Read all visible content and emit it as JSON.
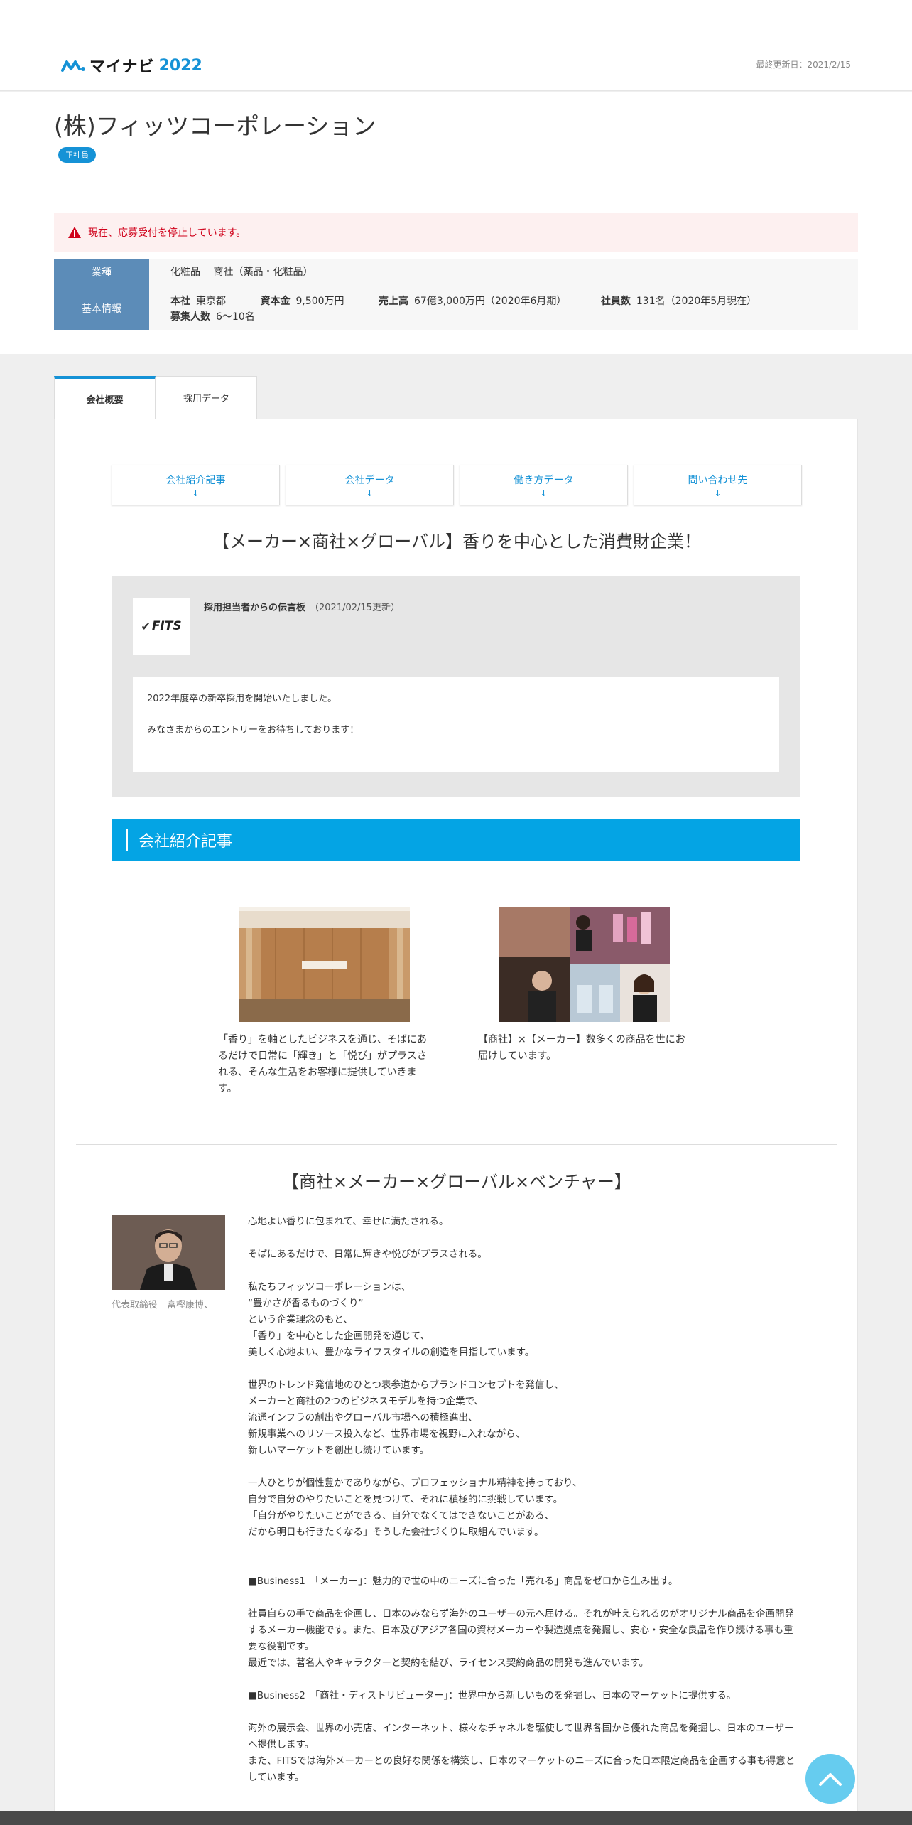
{
  "header": {
    "logo_text": "マイナビ",
    "logo_year": "2022",
    "updated": "最終更新日：2021/2/15"
  },
  "company": {
    "name": "(株)フィッツコーポレーション",
    "badge": "正社員",
    "alert": "現在、応募受付を停止しています。",
    "info": {
      "industry_label": "業種",
      "industry_value": "化粧品　 商社（薬品・化粧品）",
      "basic_label": "基本情報",
      "hq_key": "本社",
      "hq_val": "東京都",
      "capital_key": "資本金",
      "capital_val": "9,500万円",
      "sales_key": "売上高",
      "sales_val": "67億3,000万円（2020年6月期）",
      "employees_key": "社員数",
      "employees_val": "131名（2020年5月現在）",
      "recruit_key": "募集人数",
      "recruit_val": "6～10名"
    }
  },
  "tabs": [
    {
      "label": "会社概要"
    },
    {
      "label": "採用データ"
    }
  ],
  "subnav": [
    {
      "label": "会社紹介記事",
      "arrow": "↓"
    },
    {
      "label": "会社データ",
      "arrow": "↓"
    },
    {
      "label": "働き方データ",
      "arrow": "↓"
    },
    {
      "label": "問い合わせ先",
      "arrow": "↓"
    }
  ],
  "catchphrase": "【メーカー×商社×グローバル】香りを中心とした消費財企業！",
  "message": {
    "logo_text": "FITS",
    "title": "採用担当者からの伝言板",
    "date": "（2021/02/15更新）",
    "line1": "2022年度卒の新卒採用を開始いたしました。",
    "line2": "みなさまからのエントリーをお待ちしております！"
  },
  "section_title": "会社紹介記事",
  "articles": [
    {
      "caption": "「香り」を軸としたビジネスを通じ、そばにあるだけで日常に「輝き」と「悦び」がプラスされる、そんな生活をお客様に提供していきます。"
    },
    {
      "caption": "【商社】×【メーカー】数多くの商品を世にお届けしています。"
    }
  ],
  "catchphrase2": "【商社×メーカー×グローバル×ベンチャー】",
  "ceo_caption": "代表取締役　富樫康博、",
  "body": {
    "p1": "心地よい香りに包まれて、幸せに満たされる。",
    "p2": "そばにあるだけで、日常に輝きや悦びがプラスされる。",
    "p3": "私たちフィッツコーポレーションは、\n“豊かさが香るものづくり”\nという企業理念のもと、\n「香り」を中心とした企画開発を通じて、\n美しく心地よい、豊かなライフスタイルの創造を目指しています。",
    "p4": "世界のトレンド発信地のひとつ表参道からブランドコンセプトを発信し、\nメーカーと商社の2つのビジネスモデルを持つ企業で、\n流通インフラの創出やグローバル市場への積極進出、\n新規事業へのリソース投入など、世界市場を視野に入れながら、\n新しいマーケットを創出し続けています。",
    "p5": "一人ひとりが個性豊かでありながら、プロフェッショナル精神を持っており、\n自分で自分のやりたいことを見つけて、それに積極的に挑戦しています。\n「自分がやりたいことができる、自分でなくてはできないことがある、\nだから明日も行きたくなる」そうした会社づくりに取組んでいます。",
    "p6": "■Business1　「メーカー」：魅力的で世の中のニーズに合った「売れる」商品をゼロから生み出す。",
    "p7": "社員自らの手で商品を企画し、日本のみならず海外のユーザーの元へ届ける。それが叶えられるのがオリジナル商品を企画開発するメーカー機能です。また、日本及びアジア各国の資材メーカーや製造拠点を発掘し、安心・安全な良品を作り続ける事も重要な役割です。\n最近では、著名人やキャラクターと契約を結び、ライセンス契約商品の開発も進んでいます。",
    "p8": "■Business2　「商社・ディストリビューター」：世界中から新しいものを発掘し、日本のマーケットに提供する。",
    "p9": "海外の展示会、世界の小売店、インターネット、様々なチャネルを駆使して世界各国から優れた商品を発掘し、日本のユーザーへ提供します。\nまた、FITSでは海外メーカーとの良好な関係を構築し、日本のマーケットのニーズに合った日本限定商品を企画する事も得意としています。"
  },
  "colors": {
    "accent": "#1592d6",
    "section_bar": "#04a4e4",
    "alert_text": "#d0021b",
    "label_bg": "#5c8cb8"
  }
}
